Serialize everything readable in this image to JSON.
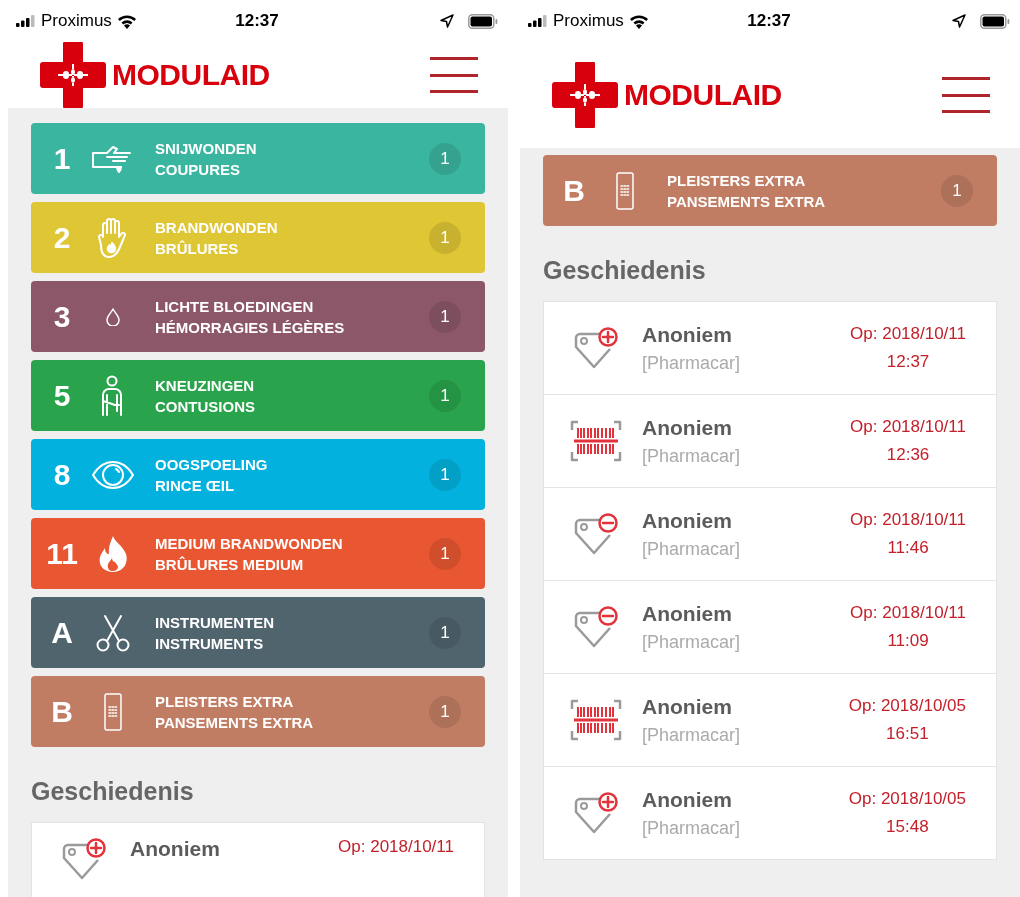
{
  "phones": [
    {
      "status_bar": {
        "carrier": "Proximus",
        "time": "12:37"
      },
      "logo": "MODULAID",
      "modules": [
        {
          "code": "1",
          "kind": "cut",
          "title": "SNIJWONDEN",
          "subtitle": "COUPURES",
          "count": "1",
          "color": "#3ab5a0"
        },
        {
          "code": "2",
          "kind": "burn",
          "title": "BRANDWONDEN",
          "subtitle": "BRÛLURES",
          "count": "1",
          "color": "#dfc634"
        },
        {
          "code": "3",
          "kind": "bleed",
          "title": "LICHTE BLOEDINGEN",
          "subtitle": "HÉMORRAGIES LÉGÈRES",
          "count": "1",
          "color": "#8c5768"
        },
        {
          "code": "5",
          "kind": "bruise",
          "title": "KNEUZINGEN",
          "subtitle": "CONTUSIONS",
          "count": "1",
          "color": "#2aa44c"
        },
        {
          "code": "8",
          "kind": "eye",
          "title": "OOGSPOELING",
          "subtitle": "RINCE ŒIL",
          "count": "1",
          "color": "#03b1de"
        },
        {
          "code": "11",
          "kind": "fire",
          "title": "MEDIUM BRANDWONDEN",
          "subtitle": "BRÛLURES MEDIUM",
          "count": "1",
          "color": "#e85731"
        },
        {
          "code": "A",
          "kind": "instruments",
          "title": "INSTRUMENTEN",
          "subtitle": "INSTRUMENTS",
          "count": "1",
          "color": "#50646e"
        },
        {
          "code": "B",
          "kind": "plaster",
          "title": "PLEISTERS EXTRA",
          "subtitle": "PANSEMENTS EXTRA",
          "count": "1",
          "color": "#c17d63"
        }
      ],
      "history_title": "Geschiedenis",
      "history": [
        {
          "kind": "add",
          "name": "Anoniem",
          "date": "Op: 2018/10/11"
        }
      ]
    },
    {
      "status_bar": {
        "carrier": "Proximus",
        "time": "12:37"
      },
      "logo": "MODULAID",
      "modules": [
        {
          "code": "B",
          "kind": "plaster",
          "title": "PLEISTERS EXTRA",
          "subtitle": "PANSEMENTS EXTRA",
          "count": "1",
          "color": "#c17d63"
        }
      ],
      "history_title": "Geschiedenis",
      "history": [
        {
          "kind": "add",
          "name": "Anoniem",
          "source": "[Pharmacar]",
          "date": "Op: 2018/10/11",
          "time": "12:37"
        },
        {
          "kind": "scan",
          "name": "Anoniem",
          "source": "[Pharmacar]",
          "date": "Op: 2018/10/11",
          "time": "12:36"
        },
        {
          "kind": "remove",
          "name": "Anoniem",
          "source": "[Pharmacar]",
          "date": "Op: 2018/10/11",
          "time": "11:46"
        },
        {
          "kind": "remove",
          "name": "Anoniem",
          "source": "[Pharmacar]",
          "date": "Op: 2018/10/11",
          "time": "11:09"
        },
        {
          "kind": "scan",
          "name": "Anoniem",
          "source": "[Pharmacar]",
          "date": "Op: 2018/10/05",
          "time": "16:51"
        },
        {
          "kind": "add",
          "name": "Anoniem",
          "source": "[Pharmacar]",
          "date": "Op: 2018/10/05",
          "time": "15:48"
        }
      ]
    }
  ]
}
